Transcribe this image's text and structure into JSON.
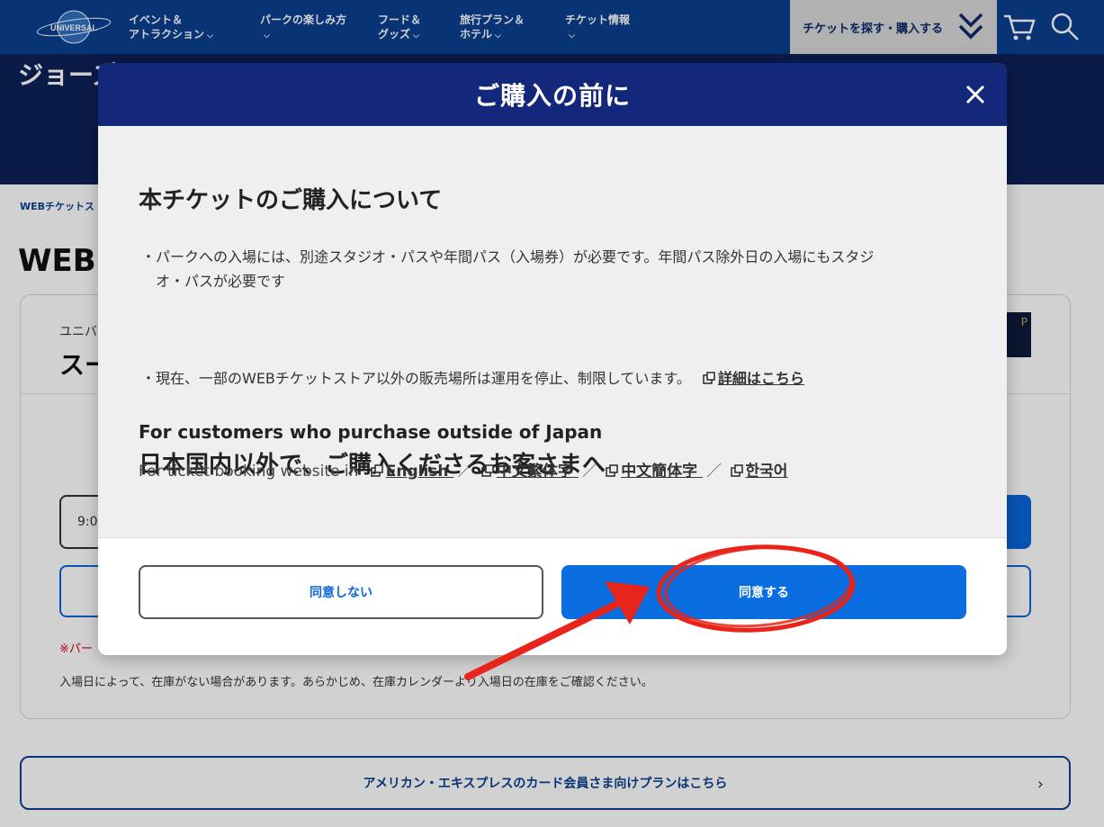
{
  "header": {
    "logo_text": "UNIVERSAL STUDIOS JAPAN",
    "nav": [
      {
        "line1": "イベント＆",
        "line2": "アトラクション"
      },
      {
        "line1": "パークの楽しみ方",
        "line2": ""
      },
      {
        "line1": "フード＆",
        "line2": "グッズ"
      },
      {
        "line1": "旅行プラン＆",
        "line2": "ホテル"
      },
      {
        "line1": "チケット情報",
        "line2": ""
      }
    ],
    "ticket_button": "チケットを探す・購入する"
  },
  "page": {
    "hero_title": "ジョーズ",
    "breadcrumb": "WEBチケットス",
    "heading": "WEB",
    "card_sub": "ユニバ",
    "card_name": "スー",
    "time_value": "9:0",
    "red_note": "※パー",
    "stock_note": "入場日によって、在庫がない場合があります。あらかじめ、在庫カレンダーより入場日の在庫をご確認ください。",
    "amex_link": "アメリカン・エキスプレスのカード会員さま向けプランはこちら"
  },
  "modal": {
    "title": "ご購入の前に",
    "section1_title": "本チケットのご購入について",
    "bullet1_line1": "パークへの入場には、別途スタジオ・パスや年間パス（入場券）が必要です。年間パス除外日の入場にもスタジ",
    "bullet1_line2": "オ・パスが必要です",
    "bullet2_text": "現在、一部のWEBチケットストア以外の販売場所は運用を停止、制限しています。",
    "bullet2_link": "詳細はこちら",
    "bullet_mark": "・",
    "section2_title": "日本国内以外で、ご購入くださるお客さまへ",
    "section2_sub": "For customers who purchase outside of Japan",
    "lang_prefix": "For ticket booking website in",
    "lang_sep": "／",
    "languages": [
      "English",
      "中文繁体字",
      "中文簡体字",
      "한국어"
    ],
    "decline_label": "同意しない",
    "agree_label": "同意する"
  },
  "colors": {
    "header_bg": "#0a3f8f",
    "modal_header_bg": "#13287a",
    "agree_bg": "#0a6ee0",
    "annotation_red": "#e8251a"
  }
}
